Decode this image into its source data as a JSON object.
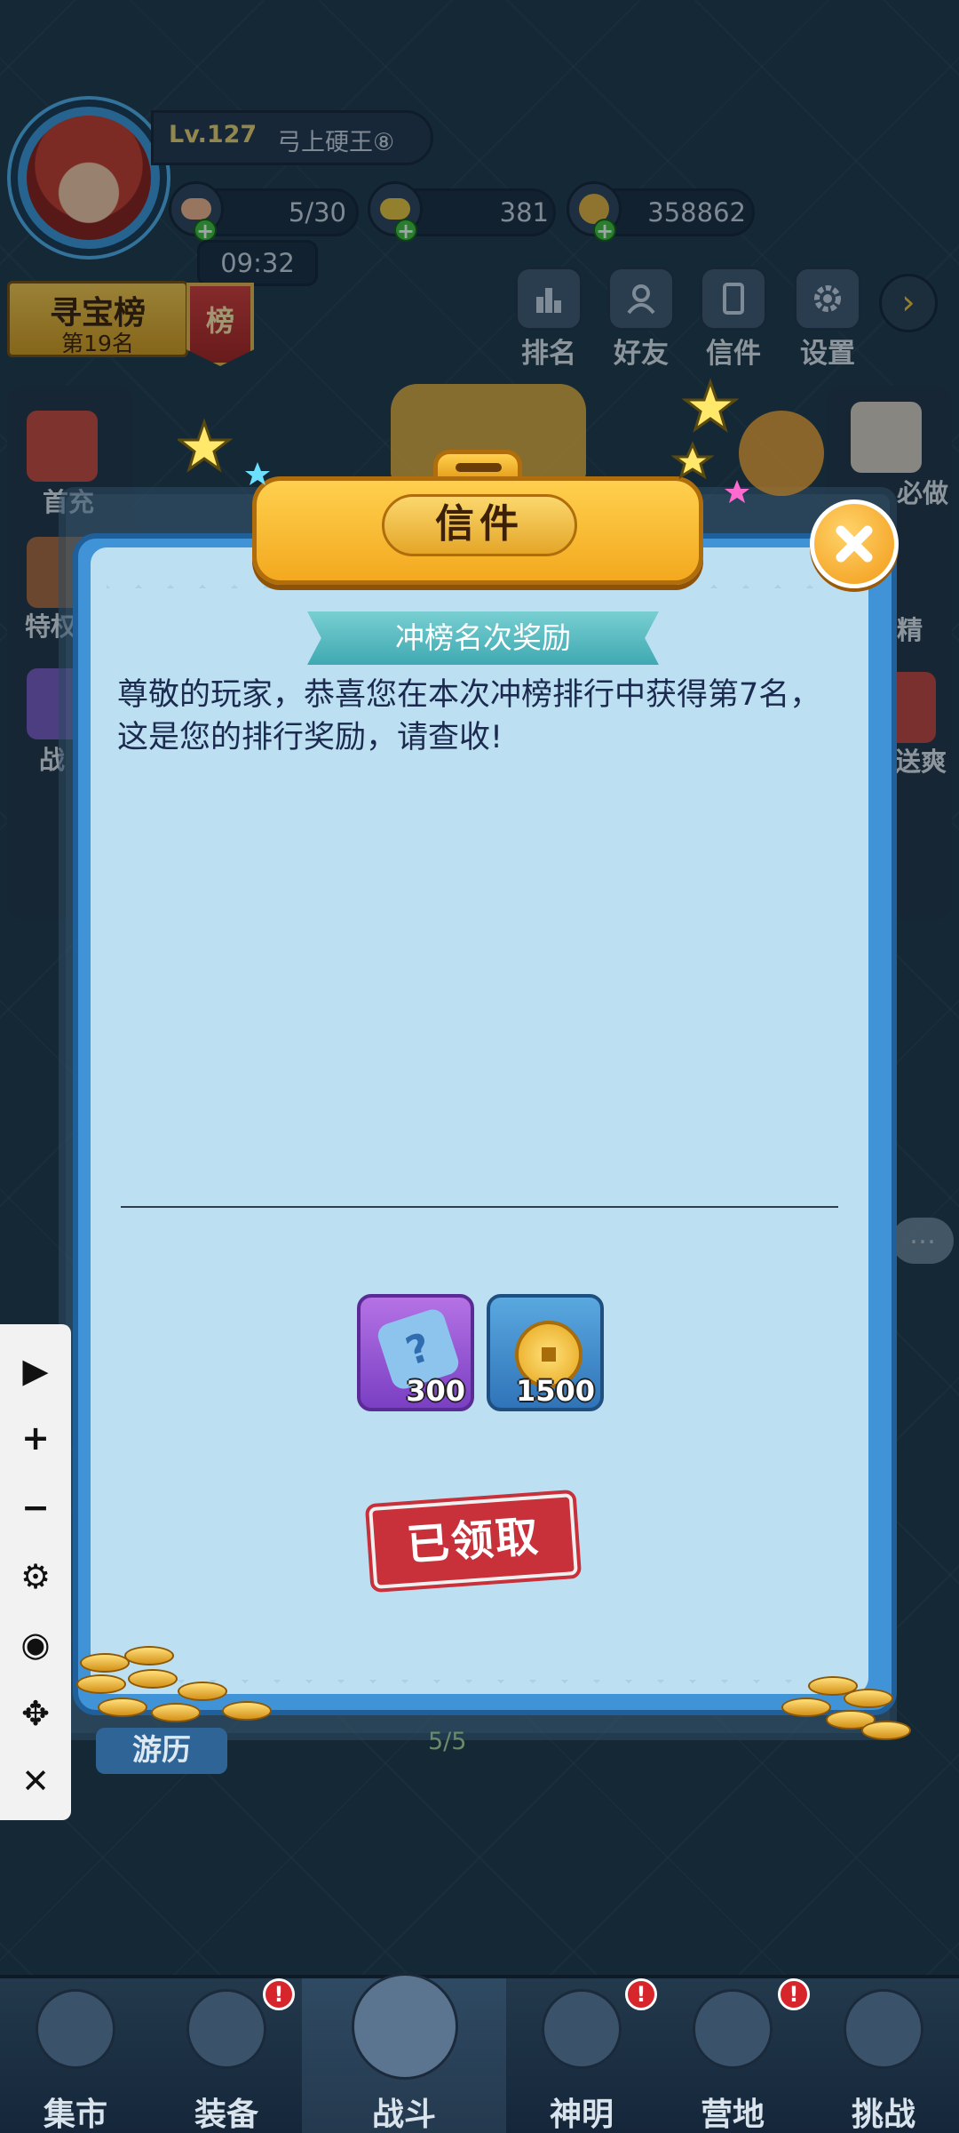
{
  "hud": {
    "level": "Lv.127",
    "player_name": "弓上硬王⑧",
    "stamina": "5/30",
    "gems": "381",
    "gold": "358862",
    "timer": "09:32",
    "treasure_title": "寻宝榜",
    "treasure_rank": "第19名",
    "medal_char": "榜"
  },
  "top_buttons": [
    {
      "label": "排名",
      "icon": "ranking-icon"
    },
    {
      "label": "好友",
      "icon": "friends-icon"
    },
    {
      "label": "信件",
      "icon": "mail-icon"
    },
    {
      "label": "设置",
      "icon": "gear-icon"
    }
  ],
  "side_left": [
    "首充",
    "特权",
    "战"
  ],
  "side_right": [
    "必做",
    "精",
    "送爽"
  ],
  "dialog": {
    "title": "信件",
    "subject": "冲榜名次奖励",
    "body_line1": "尊敬的玩家，恭喜您在本次冲榜排行中获得第7名，",
    "body_line2": "这是您的排行奖励，请查收!",
    "rewards": [
      {
        "amount": "300",
        "icon": "puzzle-fragment-icon"
      },
      {
        "amount": "1500",
        "icon": "gold-coin-icon"
      }
    ],
    "claimed_label": "已领取"
  },
  "float_toolbar": [
    "▶",
    "+",
    "−",
    "⚙",
    "◉",
    "✥",
    "✕"
  ],
  "travel_label": "游历",
  "stamina_small": "5/5",
  "bottom_nav": [
    {
      "label": "集市",
      "badge": false
    },
    {
      "label": "装备",
      "badge": true
    },
    {
      "label": "战斗",
      "badge": false,
      "active": true
    },
    {
      "label": "神明",
      "badge": true
    },
    {
      "label": "营地",
      "badge": true
    },
    {
      "label": "挑战",
      "badge": false
    }
  ],
  "badge_mark": "!",
  "colors": {
    "dialog_blue": "#3f93d6",
    "paper": "#bce0f2",
    "title_gold": "#f3a91f",
    "stamp_red": "#c8303a",
    "ribbon_teal": "#3fa9b1"
  }
}
